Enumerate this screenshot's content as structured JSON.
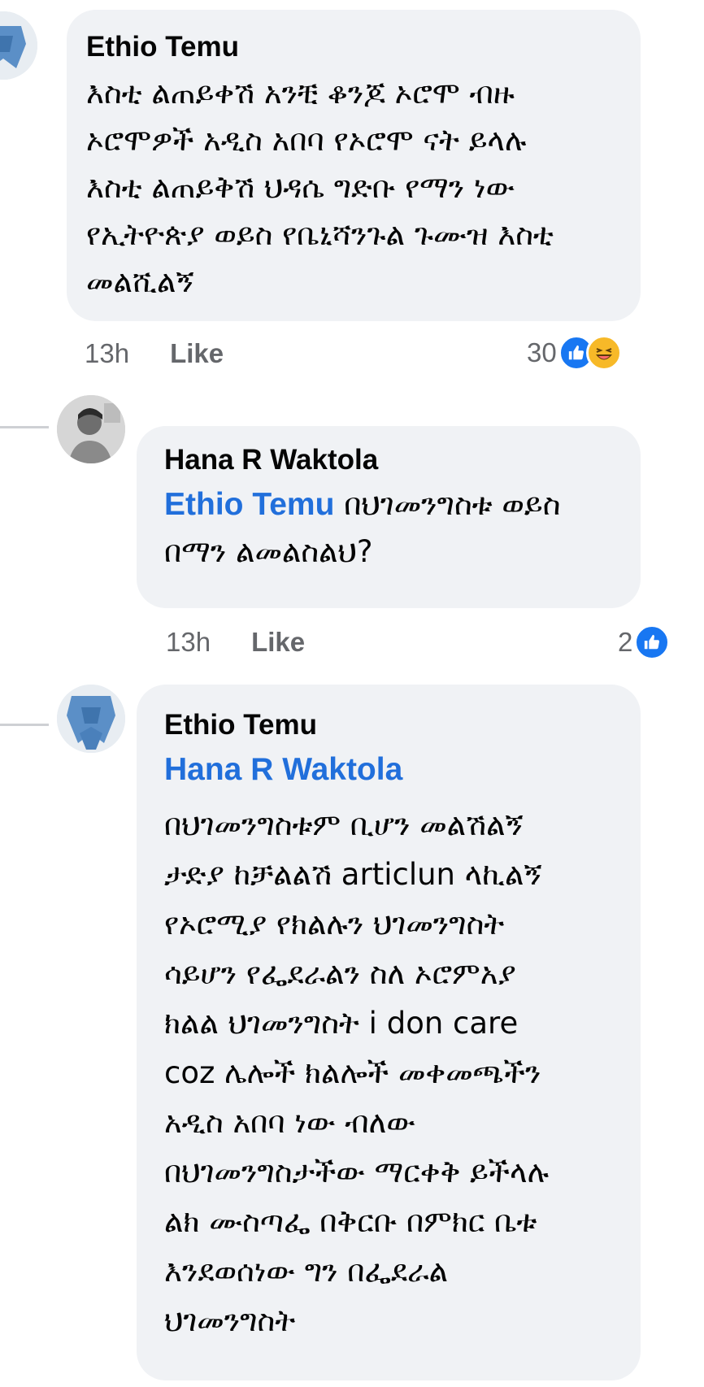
{
  "comments": [
    {
      "author": "Ethio Temu",
      "text": "እስቲ ልጠይቀሽ አንቺ ቆንጆ ኦሮሞ ብዙ\nኦሮሞዎች አዲስ አበባ የኦሮሞ ናት ይላሉ\nእስቲ ልጠይቅሽ ህዳሴ ግድቡ የማን ነው\nየኢትዮጵያ ወይስ የቤኒሻንጉል ጉሙዝ እስቲ\nመልሺልኝ",
      "time": "13h",
      "like_label": "Like",
      "reaction_count": "30",
      "reactions": [
        "like-icon",
        "haha-icon"
      ]
    },
    {
      "author": "Hana R Waktola",
      "mention": "Ethio Temu",
      "text": " በህገመንግስቱ ወይስ\nበማን ልመልስልህ?",
      "time": "13h",
      "like_label": "Like",
      "reaction_count": "2",
      "reactions": [
        "like-icon"
      ]
    },
    {
      "author": "Ethio Temu",
      "mention": "Hana R Waktola",
      "text": "በህገመንግስቱም ቢሆን መልሽልኝ\nታድያ ከቻልልሽ articlun  ላኪልኝ\nየኦሮሚያ የክልሉን ህገመንግስት\nሳይሆን የፌደራልን ስለ ኦሮምአያ\nክልል ህገመንግስት i don care\ncoz ሌሎች ክልሎች መቀመጫችን\nአዲስ አበባ ነው ብለው\nበህገመንግስታችው ማርቀቅ ይችላሉ\nልክ ሙስጣፌ በቅርቡ በምክር ቤቱ\nእንደወሰነው ግን በፌደራል\nህገመንግስት"
    }
  ],
  "colors": {
    "bubble": "#f0f2f5",
    "mention": "#216fdb",
    "meta": "#65676b",
    "like_blue": "#1877f2",
    "haha_yellow": "#f7b928"
  }
}
